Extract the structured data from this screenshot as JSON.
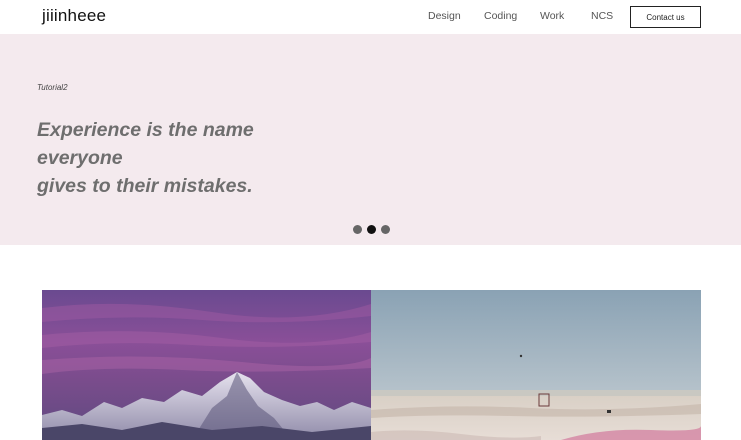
{
  "header": {
    "logo": "jiiinheee",
    "nav": [
      "Design",
      "Coding",
      "Work",
      "NCS"
    ],
    "contact_label": "Contact us"
  },
  "hero": {
    "tag": "Tutorial2",
    "quote_line1": "Experience is the name everyone",
    "quote_line2": "gives to their mistakes.",
    "background": "#f4eaee",
    "slider": {
      "count": 3,
      "active_index": 1
    }
  },
  "gallery": {
    "items": [
      {
        "subject": "purple mountain sunset photo"
      },
      {
        "subject": "pink salt lake shore photo"
      }
    ]
  }
}
